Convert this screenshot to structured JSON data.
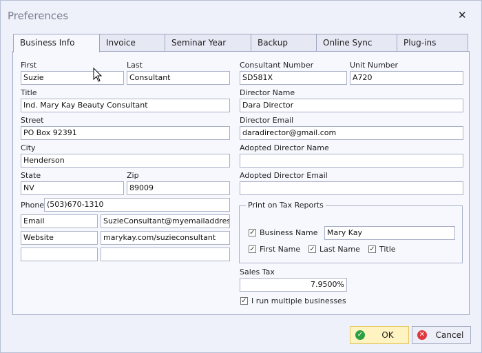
{
  "window": {
    "title": "Preferences"
  },
  "tabs": [
    "Business Info",
    "Invoice",
    "Seminar Year",
    "Backup",
    "Online Sync",
    "Plug-ins"
  ],
  "left": {
    "first_label": "First",
    "first_value": "Suzie",
    "last_label": "Last",
    "last_value": "Consultant",
    "title_label": "Title",
    "title_value": "Ind. Mary Kay Beauty Consultant",
    "street_label": "Street",
    "street_value": "PO Box 92391",
    "city_label": "City",
    "city_value": "Henderson",
    "state_label": "State",
    "state_value": "NV",
    "zip_label": "Zip",
    "zip_value": "89009",
    "phone_label": "Phone",
    "phone_value": "(503)670-1310",
    "contacts": [
      {
        "type": "Email",
        "value": "SuzieConsultant@myemailaddress.com"
      },
      {
        "type": "Website",
        "value": "marykay.com/suzieconsultant"
      },
      {
        "type": "",
        "value": ""
      }
    ]
  },
  "right": {
    "consultant_number_label": "Consultant Number",
    "consultant_number_value": "SD581X",
    "unit_number_label": "Unit Number",
    "unit_number_value": "A720",
    "director_name_label": "Director Name",
    "director_name_value": "Dara Director",
    "director_email_label": "Director Email",
    "director_email_value": "daradirector@gmail.com",
    "adopted_director_name_label": "Adopted Director Name",
    "adopted_director_name_value": "",
    "adopted_director_email_label": "Adopted Director Email",
    "adopted_director_email_value": "",
    "print_group_label": "Print on Tax Reports",
    "business_name_label": "Business Name",
    "business_name_value": "Mary Kay",
    "first_name_label": "First Name",
    "last_name_label": "Last Name",
    "title_label": "Title",
    "sales_tax_label": "Sales Tax",
    "sales_tax_value": "7.9500%",
    "multiple_businesses_label": "I run multiple businesses"
  },
  "buttons": {
    "ok": "OK",
    "cancel": "Cancel"
  },
  "colors": {
    "ok_bg": "#fff3c2",
    "ok_icon": "#2ea043",
    "cancel_icon": "#e0383e"
  }
}
